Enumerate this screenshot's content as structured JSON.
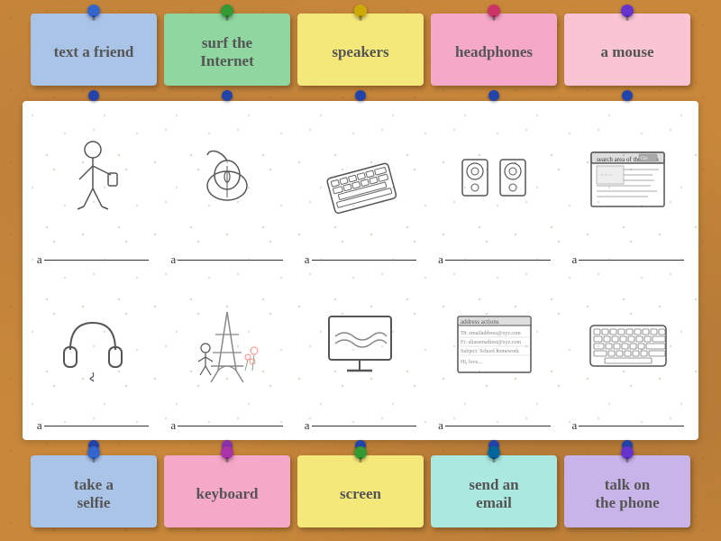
{
  "top_notes": [
    {
      "label": "text a\nfriend",
      "color": "blue",
      "pin": "pin-blue"
    },
    {
      "label": "surf the\nInternet",
      "color": "green",
      "pin": "pin-green"
    },
    {
      "label": "speakers",
      "color": "yellow",
      "pin": "pin-yellow-pin"
    },
    {
      "label": "headphones",
      "color": "pink",
      "pin": "pin-pink"
    },
    {
      "label": "a mouse",
      "color": "lightpink",
      "pin": "pin-purple"
    }
  ],
  "bottom_notes": [
    {
      "label": "take a\nselfie",
      "color": "blue",
      "pin": "pin-blue"
    },
    {
      "label": "keyboard",
      "color": "pink",
      "pin": "pin-red"
    },
    {
      "label": "screen",
      "color": "yellow",
      "pin": "pin-green"
    },
    {
      "label": "send an\nemail",
      "color": "cyan",
      "pin": "pin-teal"
    },
    {
      "label": "talk on\nthe phone",
      "color": "lavender",
      "pin": "pin-purple"
    }
  ],
  "cells": [
    {
      "row": 1,
      "col": 1,
      "name": "person-texting"
    },
    {
      "row": 1,
      "col": 2,
      "name": "mouse"
    },
    {
      "row": 1,
      "col": 3,
      "name": "keyboard-top"
    },
    {
      "row": 1,
      "col": 4,
      "name": "speakers"
    },
    {
      "row": 1,
      "col": 5,
      "name": "website"
    },
    {
      "row": 2,
      "col": 1,
      "name": "headphones"
    },
    {
      "row": 2,
      "col": 2,
      "name": "eiffel-tower"
    },
    {
      "row": 2,
      "col": 3,
      "name": "screen"
    },
    {
      "row": 2,
      "col": 4,
      "name": "email"
    },
    {
      "row": 2,
      "col": 5,
      "name": "keyboard-bottom"
    }
  ]
}
